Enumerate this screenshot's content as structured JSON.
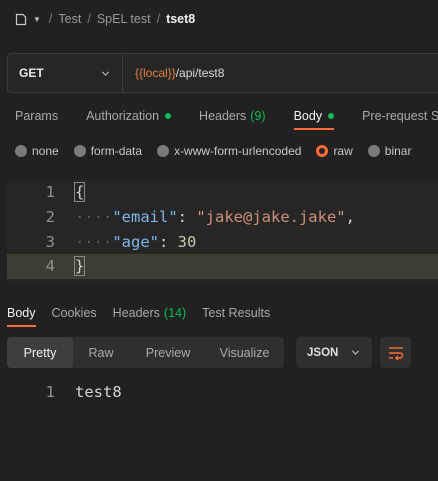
{
  "breadcrumb": {
    "icon": "document-icon",
    "items": [
      "Test",
      "SpEL test"
    ],
    "current": "tset8",
    "separator": "/"
  },
  "request": {
    "method": "GET",
    "url_variable": "{{local}}",
    "url_path": "/api/test8"
  },
  "request_tabs": [
    {
      "label": "Params"
    },
    {
      "label": "Authorization",
      "indicator": "dot"
    },
    {
      "label": "Headers",
      "count": "(9)"
    },
    {
      "label": "Body",
      "indicator": "dot",
      "active": true
    },
    {
      "label": "Pre-request Sc"
    }
  ],
  "body_types": [
    {
      "label": "none"
    },
    {
      "label": "form-data"
    },
    {
      "label": "x-www-form-urlencoded"
    },
    {
      "label": "raw",
      "selected": true
    },
    {
      "label": "binar"
    }
  ],
  "editor": {
    "lines": [
      {
        "num": "1",
        "text": "{"
      },
      {
        "num": "2",
        "key": "\"email\"",
        "colon": ": ",
        "value": "\"jake@jake.jake\"",
        "trail": ","
      },
      {
        "num": "3",
        "key": "\"age\"",
        "colon": ": ",
        "value": "30"
      },
      {
        "num": "4",
        "text": "}"
      }
    ],
    "indent_marks": "····"
  },
  "response_tabs": [
    {
      "label": "Body",
      "active": true
    },
    {
      "label": "Cookies"
    },
    {
      "label": "Headers",
      "count": "(14)"
    },
    {
      "label": "Test Results"
    }
  ],
  "view_modes": [
    "Pretty",
    "Raw",
    "Preview",
    "Visualize"
  ],
  "active_view": "Pretty",
  "format": "JSON",
  "response_body": {
    "num": "1",
    "text": "test8"
  },
  "colors": {
    "accent": "#ff6c37",
    "success": "#0cbb52",
    "background": "#212121"
  }
}
